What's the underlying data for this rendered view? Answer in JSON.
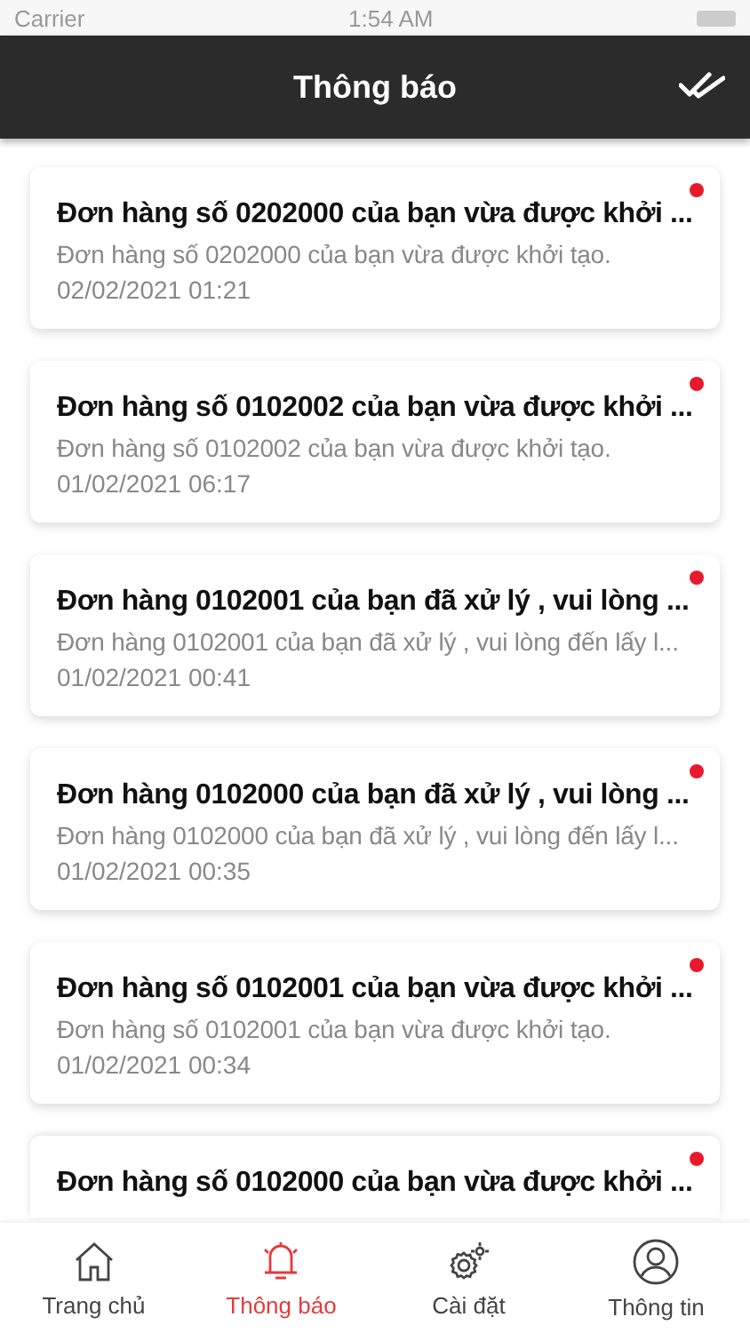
{
  "status_bar": {
    "carrier": "Carrier",
    "time": "1:54 AM"
  },
  "header": {
    "title": "Thông báo"
  },
  "notifications": [
    {
      "title": "Đơn hàng số 0202000 của bạn vừa được khởi ...",
      "body": "Đơn hàng số 0202000 của bạn vừa được khởi tạo.",
      "time": "02/02/2021 01:21",
      "unread": true
    },
    {
      "title": "Đơn hàng số 0102002 của bạn vừa được khởi ...",
      "body": "Đơn hàng số 0102002 của bạn vừa được khởi tạo.",
      "time": "01/02/2021 06:17",
      "unread": true
    },
    {
      "title": "Đơn hàng 0102001 của bạn đã xử lý , vui lòng ...",
      "body": "Đơn hàng 0102001 của bạn đã xử lý , vui lòng đến lấy l...",
      "time": "01/02/2021 00:41",
      "unread": true
    },
    {
      "title": "Đơn hàng 0102000 của bạn đã xử lý , vui lòng ...",
      "body": "Đơn hàng 0102000 của bạn đã xử lý , vui lòng đến lấy l...",
      "time": "01/02/2021 00:35",
      "unread": true
    },
    {
      "title": "Đơn hàng số 0102001 của bạn vừa được khởi ...",
      "body": "Đơn hàng số 0102001 của bạn vừa được khởi tạo.",
      "time": "01/02/2021 00:34",
      "unread": true
    },
    {
      "title": "Đơn hàng số 0102000 của bạn vừa được khởi ...",
      "unread": true
    }
  ],
  "tabs": [
    {
      "label": "Trang chủ",
      "kind": "home",
      "selected": false
    },
    {
      "label": "Thông báo",
      "kind": "bell",
      "selected": true
    },
    {
      "label": "Cài đặt",
      "kind": "gear",
      "selected": false
    },
    {
      "label": "Thông tin",
      "kind": "user",
      "selected": false
    }
  ]
}
